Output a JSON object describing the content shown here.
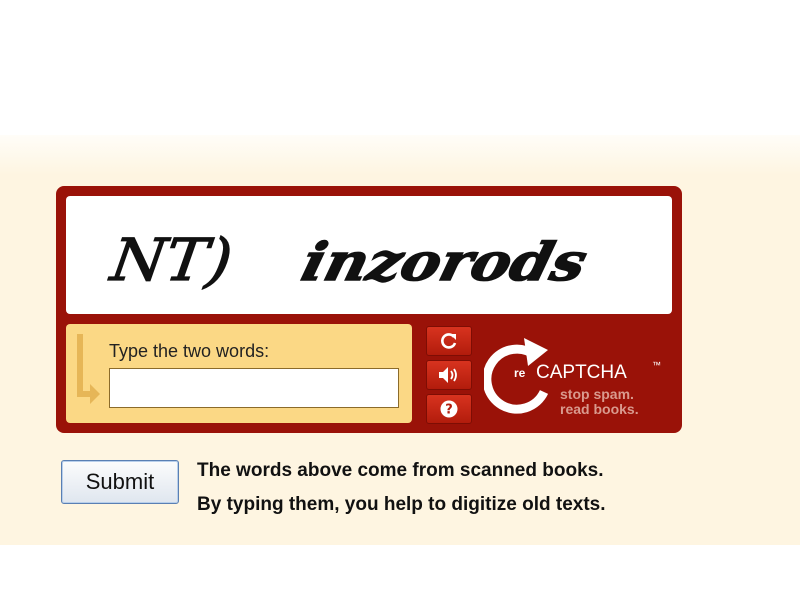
{
  "captcha": {
    "word_1": "NT)",
    "word_2": "inzorods"
  },
  "response": {
    "label": "Type the two words:",
    "value": ""
  },
  "controls": {
    "refresh_icon": "refresh-icon",
    "audio_icon": "audio-icon",
    "help_icon": "help-icon"
  },
  "branding": {
    "logo_prefix": "re",
    "logo_name": "CAPTCHA",
    "trademark": "™",
    "slogan_line_1": "stop spam.",
    "slogan_line_2": "read books."
  },
  "form": {
    "submit_label": "Submit"
  },
  "help": {
    "line_1": "The words above come from scanned books.",
    "line_2": "By typing them, you help to digitize old texts."
  },
  "colors": {
    "widget_red": "#9a1208",
    "response_yellow": "#fbd885",
    "background_cream": "#fef5e1"
  }
}
